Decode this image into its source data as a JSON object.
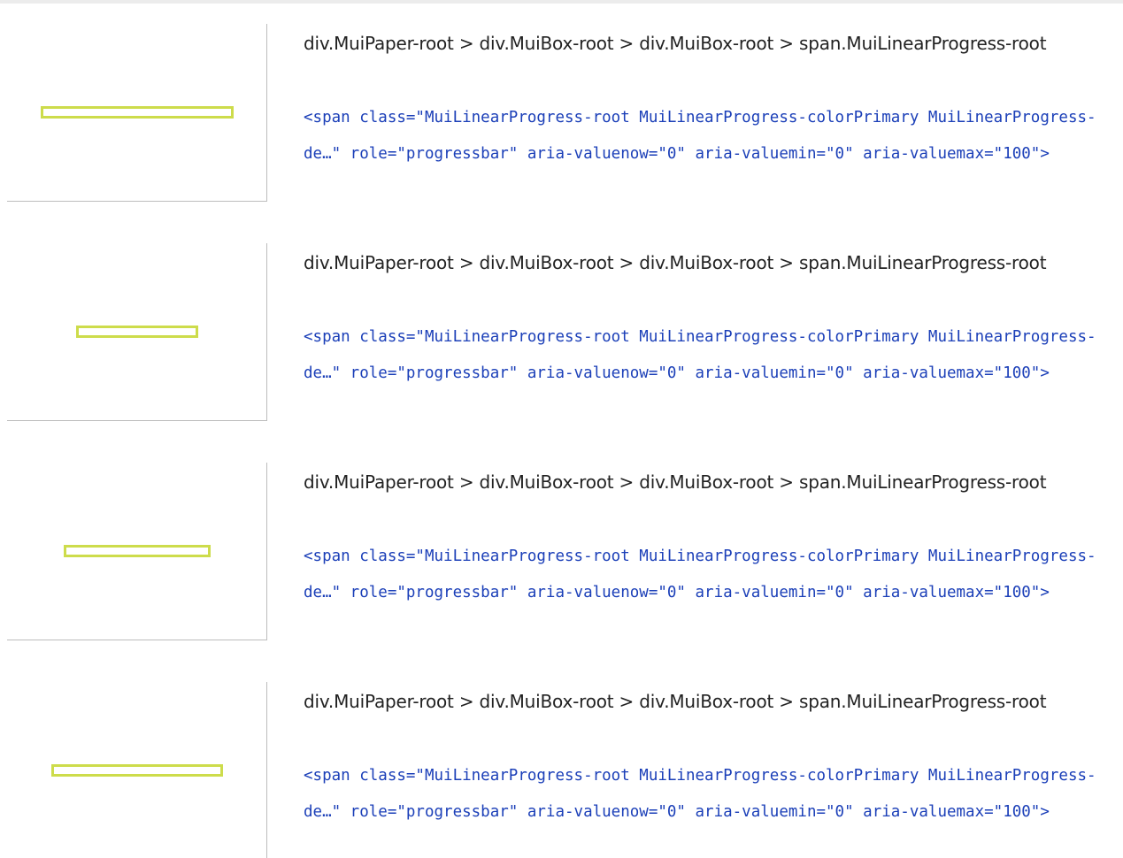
{
  "results": [
    {
      "selector": "div.MuiPaper-root > div.MuiBox-root > div.MuiBox-root > span.MuiLinearProgress-root",
      "snippet": "<span class=\"MuiLinearProgress-root MuiLinearProgress-colorPrimary MuiLinearProgress-de…\" role=\"progressbar\" aria-valuenow=\"0\" aria-valuemin=\"0\" aria-valuemax=\"100\">"
    },
    {
      "selector": "div.MuiPaper-root > div.MuiBox-root > div.MuiBox-root > span.MuiLinearProgress-root",
      "snippet": "<span class=\"MuiLinearProgress-root MuiLinearProgress-colorPrimary MuiLinearProgress-de…\" role=\"progressbar\" aria-valuenow=\"0\" aria-valuemin=\"0\" aria-valuemax=\"100\">"
    },
    {
      "selector": "div.MuiPaper-root > div.MuiBox-root > div.MuiBox-root > span.MuiLinearProgress-root",
      "snippet": "<span class=\"MuiLinearProgress-root MuiLinearProgress-colorPrimary MuiLinearProgress-de…\" role=\"progressbar\" aria-valuenow=\"0\" aria-valuemin=\"0\" aria-valuemax=\"100\">"
    },
    {
      "selector": "div.MuiPaper-root > div.MuiBox-root > div.MuiBox-root > span.MuiLinearProgress-root",
      "snippet": "<span class=\"MuiLinearProgress-root MuiLinearProgress-colorPrimary MuiLinearProgress-de…\" role=\"progressbar\" aria-valuenow=\"0\" aria-valuemin=\"0\" aria-valuemax=\"100\">"
    }
  ],
  "colors": {
    "highlight": "#cddc4b",
    "snippet_text": "#1b3fb8",
    "selector_text": "#222222"
  }
}
